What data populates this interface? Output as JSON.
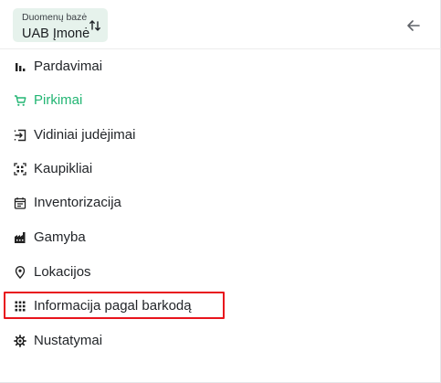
{
  "header": {
    "db_label": "Duomenų bazė",
    "db_name": "UAB Įmonė",
    "swap_icon": "swap-vertical-icon",
    "back_icon": "arrow-left-icon"
  },
  "menu": {
    "items": [
      {
        "label": "Pardavimai",
        "icon": "bar-chart-icon",
        "active": false
      },
      {
        "label": "Pirkimai",
        "icon": "shopping-cart-icon",
        "active": true
      },
      {
        "label": "Vidiniai judėjimai",
        "icon": "move-in-icon",
        "active": false
      },
      {
        "label": "Kaupikliai",
        "icon": "qr-scan-icon",
        "active": false
      },
      {
        "label": "Inventorizacija",
        "icon": "calendar-list-icon",
        "active": false
      },
      {
        "label": "Gamyba",
        "icon": "factory-icon",
        "active": false
      },
      {
        "label": "Lokacijos",
        "icon": "location-pin-icon",
        "active": false
      },
      {
        "label": "Informacija pagal barkodą",
        "icon": "grid-icon",
        "active": false,
        "highlighted": true
      },
      {
        "label": "Nustatymai",
        "icon": "gear-icon",
        "active": false
      }
    ]
  },
  "colors": {
    "accent": "#22b573",
    "chip_bg": "#e6f2ec",
    "highlight": "#e8141c",
    "text": "#222529"
  }
}
